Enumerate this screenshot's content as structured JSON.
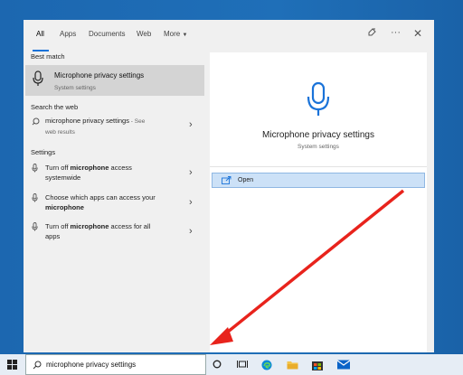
{
  "tabs": [
    "All",
    "Apps",
    "Documents",
    "Web",
    "More"
  ],
  "best_match": {
    "section": "Best match",
    "title": "Microphone privacy settings",
    "subtitle": "System settings"
  },
  "web": {
    "section": "Search the web",
    "query": "microphone privacy settings",
    "suffix": " - See",
    "suffix2": "web results"
  },
  "settings": {
    "section": "Settings",
    "items": [
      {
        "pre": "Turn off ",
        "bold": "microphone",
        "post": " access",
        "line2": "systemwide"
      },
      {
        "pre": "Choose which apps can access your",
        "bold": "microphone",
        "post": "",
        "line2": ""
      },
      {
        "pre": "Turn off ",
        "bold": "microphone",
        "post": " access for all",
        "line2": "apps"
      }
    ]
  },
  "detail": {
    "title": "Microphone privacy settings",
    "subtitle": "System settings",
    "open_label": "Open"
  },
  "taskbar": {
    "search_value": "microphone privacy settings"
  },
  "colors": {
    "accent": "#1a73d9",
    "arrow": "#e8231c",
    "desktop": "#1e6bb3"
  }
}
